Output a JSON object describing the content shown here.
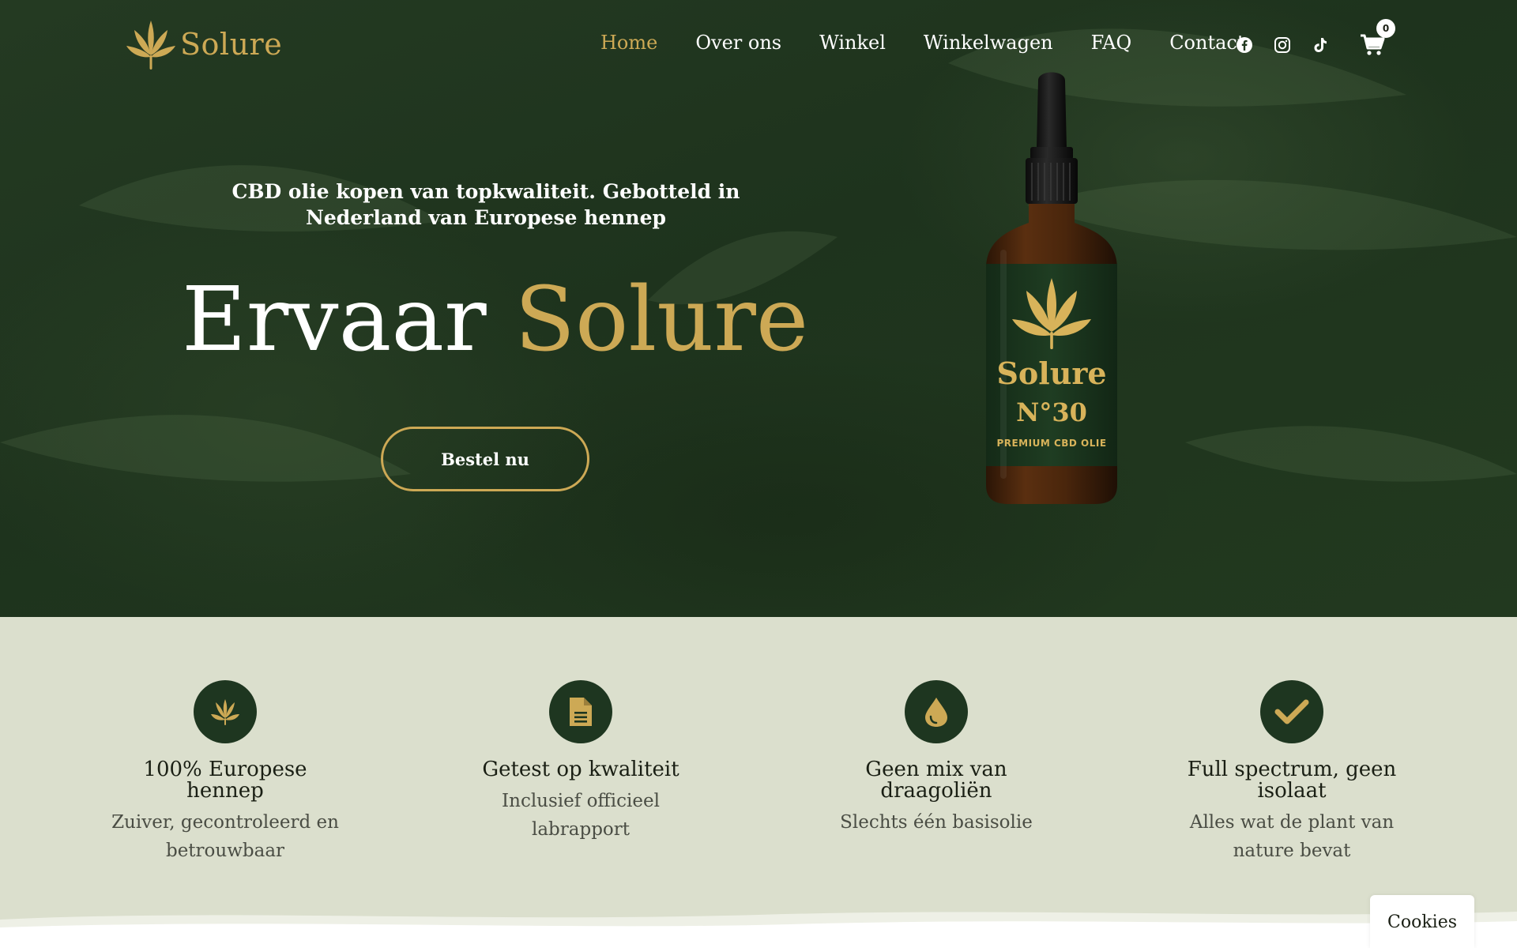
{
  "brand": {
    "name": "Solure",
    "logo_icon": "hemp-leaf-icon"
  },
  "nav": {
    "items": [
      {
        "label": "Home",
        "active": true
      },
      {
        "label": "Over ons",
        "active": false
      },
      {
        "label": "Winkel",
        "active": false
      },
      {
        "label": "Winkelwagen",
        "active": false
      },
      {
        "label": "FAQ",
        "active": false
      },
      {
        "label": "Contact",
        "active": false
      }
    ]
  },
  "social": {
    "icons": [
      "facebook-icon",
      "instagram-icon",
      "tiktok-icon"
    ]
  },
  "cart": {
    "icon": "cart-icon",
    "count": "0"
  },
  "hero": {
    "tagline": "CBD olie kopen van topkwaliteit. Gebotteld in Nederland van Europese hennep",
    "headline_white": "Ervaar",
    "headline_gold": "Solure",
    "cta_label": "Bestel nu"
  },
  "product": {
    "name": "Solure",
    "number": "N°30",
    "subtitle": "PREMIUM CBD OLIE"
  },
  "features": [
    {
      "icon": "hemp-leaf-icon",
      "title": "100% Europese hennep",
      "text": "Zuiver, gecontroleerd en betrouwbaar"
    },
    {
      "icon": "document-icon",
      "title": "Getest op kwaliteit",
      "text": "Inclusief officieel labrapport"
    },
    {
      "icon": "drop-icon",
      "title": "Geen mix van draagoliën",
      "text": "Slechts één basisolie"
    },
    {
      "icon": "check-icon",
      "title": "Full spectrum, geen isolaat",
      "text": "Alles wat de plant van nature bevat"
    }
  ],
  "cookies": {
    "label": "Cookies"
  },
  "colors": {
    "accent": "#cda955",
    "hero_bg": "#22391f",
    "features_bg": "#dbdfcd",
    "icon_circle": "#1e3620"
  }
}
